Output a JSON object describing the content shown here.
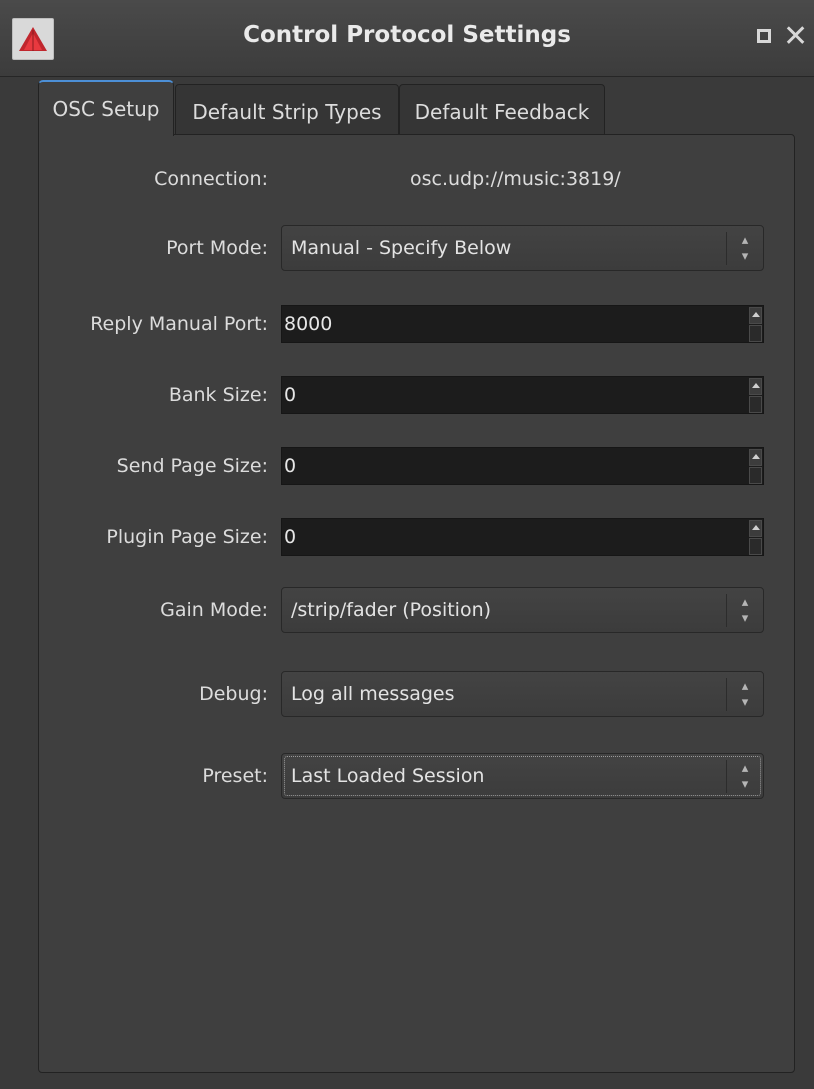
{
  "window": {
    "title": "Control Protocol Settings",
    "icons": [
      "ardour-logo-icon",
      "maximize-icon",
      "close-icon"
    ],
    "accent_color": "#4c8fd6"
  },
  "tabs": [
    {
      "label": "OSC Setup",
      "active": true
    },
    {
      "label": "Default Strip Types",
      "active": false
    },
    {
      "label": "Default Feedback",
      "active": false
    }
  ],
  "osc": {
    "connection_label": "Connection:",
    "connection_value": "osc.udp://music:3819/",
    "port_mode_label": "Port Mode:",
    "port_mode_value": "Manual - Specify Below",
    "reply_port_label": "Reply Manual Port:",
    "reply_port_value": "8000",
    "bank_size_label": "Bank Size:",
    "bank_size_value": "0",
    "send_page_size_label": "Send Page Size:",
    "send_page_size_value": "0",
    "plugin_page_size_label": "Plugin Page Size:",
    "plugin_page_size_value": "0",
    "gain_mode_label": "Gain Mode:",
    "gain_mode_value": "/strip/fader (Position)",
    "debug_label": "Debug:",
    "debug_value": "Log all messages",
    "preset_label": "Preset:",
    "preset_value": "Last Loaded Session"
  }
}
